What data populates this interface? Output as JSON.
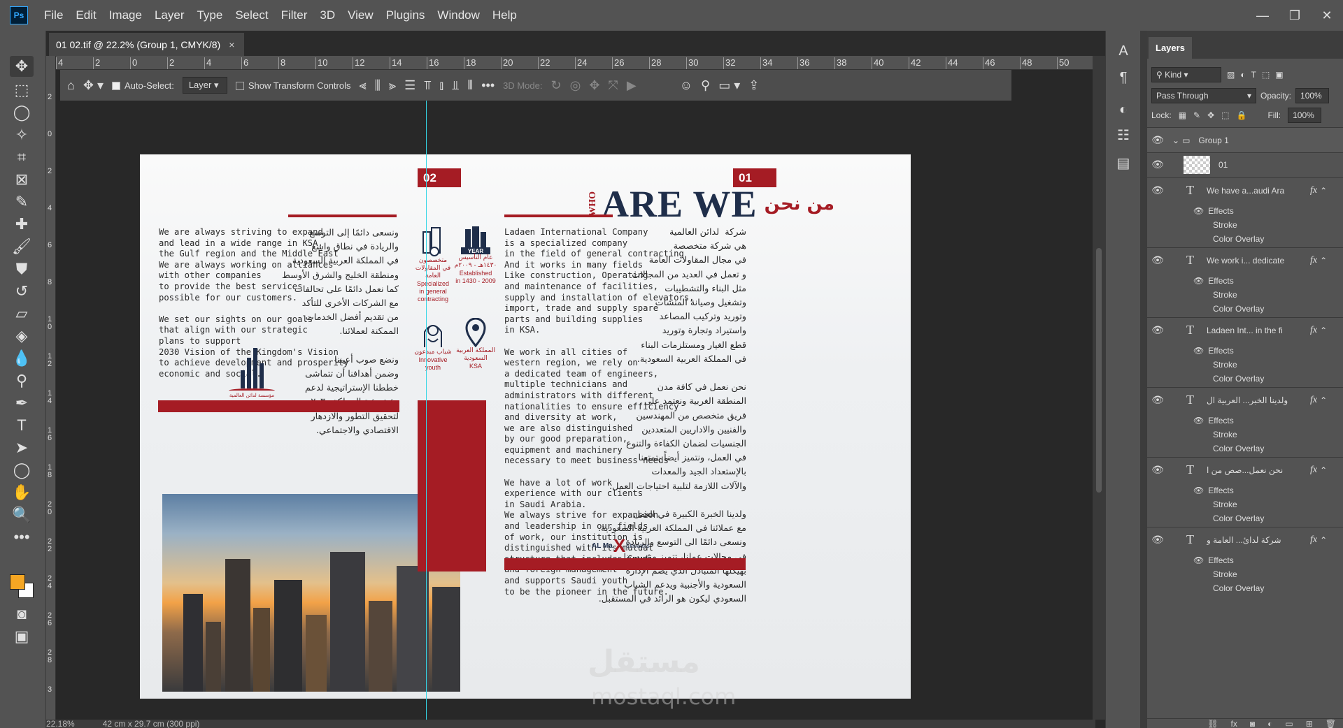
{
  "app": {
    "logo": "Ps"
  },
  "menu": [
    "File",
    "Edit",
    "Image",
    "Layer",
    "Type",
    "Select",
    "Filter",
    "3D",
    "View",
    "Plugins",
    "Window",
    "Help"
  ],
  "document_tab": {
    "title": "01 02.tif @ 22.2% (Group 1, CMYK/8)",
    "close": "×"
  },
  "options_bar": {
    "auto_select_label": "Auto-Select:",
    "auto_select_value": "Layer",
    "transform_controls_label": "Show Transform Controls",
    "mode_3d_label": "3D Mode:",
    "more": "•••"
  },
  "ruler_top": [
    "4",
    "2",
    "0",
    "2",
    "4",
    "6",
    "8",
    "10",
    "12",
    "14",
    "16",
    "18",
    "20",
    "22",
    "24",
    "26",
    "28",
    "30",
    "32",
    "34",
    "36",
    "38",
    "40",
    "42",
    "44",
    "46",
    "48",
    "50"
  ],
  "ruler_left": [
    "2",
    "0",
    "2",
    "4",
    "6",
    "8",
    "10",
    "12",
    "14",
    "16",
    "18",
    "20",
    "22",
    "24",
    "26",
    "28",
    "3"
  ],
  "status": {
    "zoom": "22.18%",
    "doc_size": "42 cm x 29.7 cm (300 ppi)"
  },
  "colors": {
    "foreground": "#f5a623",
    "background": "#ffffff",
    "accent_red": "#a51c24",
    "navy": "#1f2e4a"
  },
  "artwork": {
    "page_left_num": "02",
    "page_right_num": "01",
    "title_who": "WHO",
    "title_main": "ARE WE",
    "title_ar": "من نحن",
    "left_en": "We are always striving to expand\nand lead in a wide range in KSA,\nthe Gulf region and the Middle East\nWe are always working on alliances\nwith other companies\nto provide the best services\npossible for our customers.\n\nWe set our sights on our goals\nthat align with our strategic\nplans to support\n2030 Vision of the Kingdom's Vision\nto achieve development and prosperity\neconomic and social.",
    "left_ar": "ونسعى دائمًا إلى التوسع\nوالريادة في نطاق واسع\nفي المملكة العربية السعودية\nومنطقة الخليج والشرق الأوسط\nكما نعمل دائمًا على تحالفات\nمع الشركات الأخرى للتأكد\nمن تقديم أفضل الخدمات\nالممكنة لعملائنا.\n\nونضع صوب أعيننا\nوضمن أهدافنا أن تتماشى\nخططنا الإستراتيجية لدعم\nرؤية رؤية المملكة ٢٠٣٠\nلتحقيق التطور والازدهار\nالاقتصادي والاجتماعي.",
    "logo_caption": "مؤسسة لدائن العالمية",
    "icons": [
      {
        "name": "building-gear-icon",
        "ar": "متخصصون\nفي المقاولات\nالعامة",
        "en": "Specialized\nin general\ncontracting"
      },
      {
        "name": "building-year-icon",
        "year": "YEAR",
        "ar": "عام التأسيس\n١٤٣٠هـ - ٢٠٠٩م",
        "en": "Established\nin 1430 - 2009"
      },
      {
        "name": "saudi-man-icon",
        "ar": "شباب مبدعون",
        "en": "Innovative\nyouth"
      },
      {
        "name": "location-pin-icon",
        "ar": "المملكة العربية\nالسعودية",
        "en": "KSA"
      }
    ],
    "right_en": "Ladaen International Company\nis a specialized company\nin the field of general contracting\nAnd it works in many fields\nLike construction, Operating\nand maintenance of facilities,\nsupply and installation of elevators,\nimport, trade and supply spare\nparts and building supplies\nin KSA.\n\nWe work in all cities of\nwestern region, we rely on\na dedicated team of engineers,\nmultiple technicians and\nadministrators with different\nnationalities to ensure efficiency\nand diversity at work,\nwe are also distinguished\nby our good preparation,\nequipment and machinery\nnecessary to meet business needs\n\nWe have a lot of work\nexperience with our clients\nin Saudi Arabia.\nWe always strive for expansion\nand leadership in our fields\nof work, our institution is\ndistinguished with its mutual\nstructure that includes Saudi\nand foreign management\nand supports Saudi youth\nto be the pioneer in the future.",
    "right_ar": "شركة  لدائن العالمية\nهي شركة متخصصة\nفي مجال المقاولات العامة\nو تعمل في العديد من المجالات\nمثل البناء والتشطيبات\nوتشغيل وصيانة المنشآت\nوتوريد وتركيب المصاعد\nواستيراد وتجارة وتوريد\nقطع الغيار ومستلزمات البناء\nفي المملكة العربية السعودية.\n\nنحن نعمل في كافة مدن\nالمنطقة الغربية ونعتمد على\nفريق متخصص من المهندسين\nوالفنيين والاداريين المتعددين\nالجنسيات لضمان الكفاءة والتنوع\nفي العمل، ونتميز أيضاً بتمتعنا\nبالإستعداد الجيد والمعدات\nوالآلات اللازمة لتلبية احتياجات العمل.\n\nولدينا الخبرة الكبيرة في العمل\nمع عملائنا في المملكة العربية السعودية.\nونسعى دائمًا الى التوسع والريادة\nفي مجالات عملنا، تتميز مؤسستنا\nبهيكلها المتبادل الذي يضم الإدارة\nالسعودية والأجنبية ويدعم الشباب\nالسعودي ليكون هو الرائد في المستقبل.",
    "brand_left": "AL Ma",
    "brand_x": "X",
    "brand_right": "Elevators",
    "watermark": "مستقل",
    "watermark_url": "mostaql.com"
  },
  "layers_panel": {
    "tab": "Layers",
    "filter_kind": "Kind",
    "blend_mode": "Pass Through",
    "opacity_label": "Opacity:",
    "opacity_value": "100%",
    "lock_label": "Lock:",
    "fill_label": "Fill:",
    "fill_value": "100%",
    "group_name": "Group 1",
    "image_layer": "01",
    "effects_label": "Effects",
    "stroke_label": "Stroke",
    "color_overlay_label": "Color Overlay",
    "text_layers": [
      "We have a...audi Ara",
      "We work i... dedicate",
      "Ladaen Int... in the fi",
      "ولدينا الخبر... العربية ال",
      "نحن نعمل...صص من ا",
      "شركة لدائ... العامة و"
    ]
  }
}
